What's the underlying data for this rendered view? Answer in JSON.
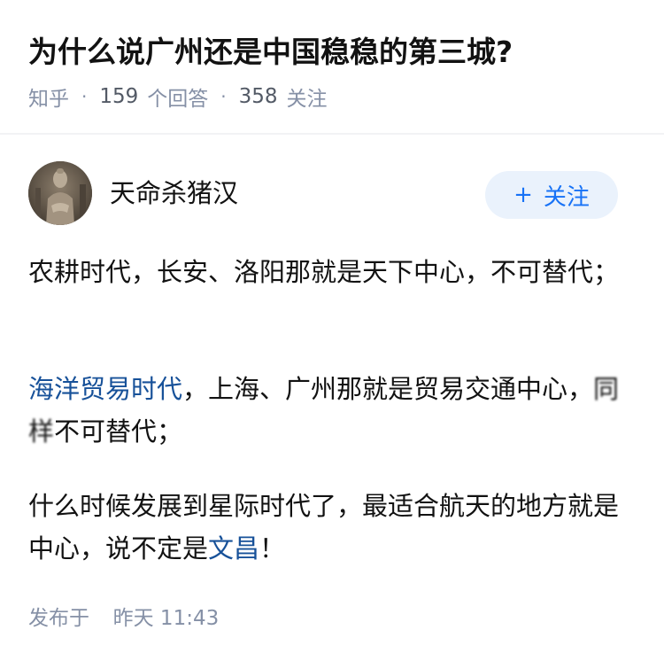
{
  "question": {
    "title": "为什么说广州还是中国稳稳的第三城?",
    "source": "知乎",
    "answer_count": "159",
    "answer_label": "个回答",
    "follower_count": "358",
    "follower_label": "关注",
    "separator": "·"
  },
  "author": {
    "name": "天命杀猪汉",
    "avatar_icon": "buddha-statue-avatar",
    "follow_plus": "+",
    "follow_label": "关注"
  },
  "answer": {
    "p1_text": "农耕时代，长安、洛阳那就是天下中心，不可替代；",
    "p2_link": "海洋贸易时代",
    "p2_text_a": "，上海、广州那就是贸易交通中心，",
    "p2_blur": "同样",
    "p2_text_b": "不可替代；",
    "p3_text": "什么时候发展到星际时代了，最适合航天的地方就是中心，说不定是",
    "p3_link": "文昌",
    "p3_end": "！"
  },
  "footer": {
    "published_label": "发布于",
    "published_time": "昨天 11:43"
  },
  "colors": {
    "link": "#175199",
    "follow_bg": "#eaf2fc",
    "follow_text": "#1772f6",
    "meta_gray": "#8590a6"
  }
}
